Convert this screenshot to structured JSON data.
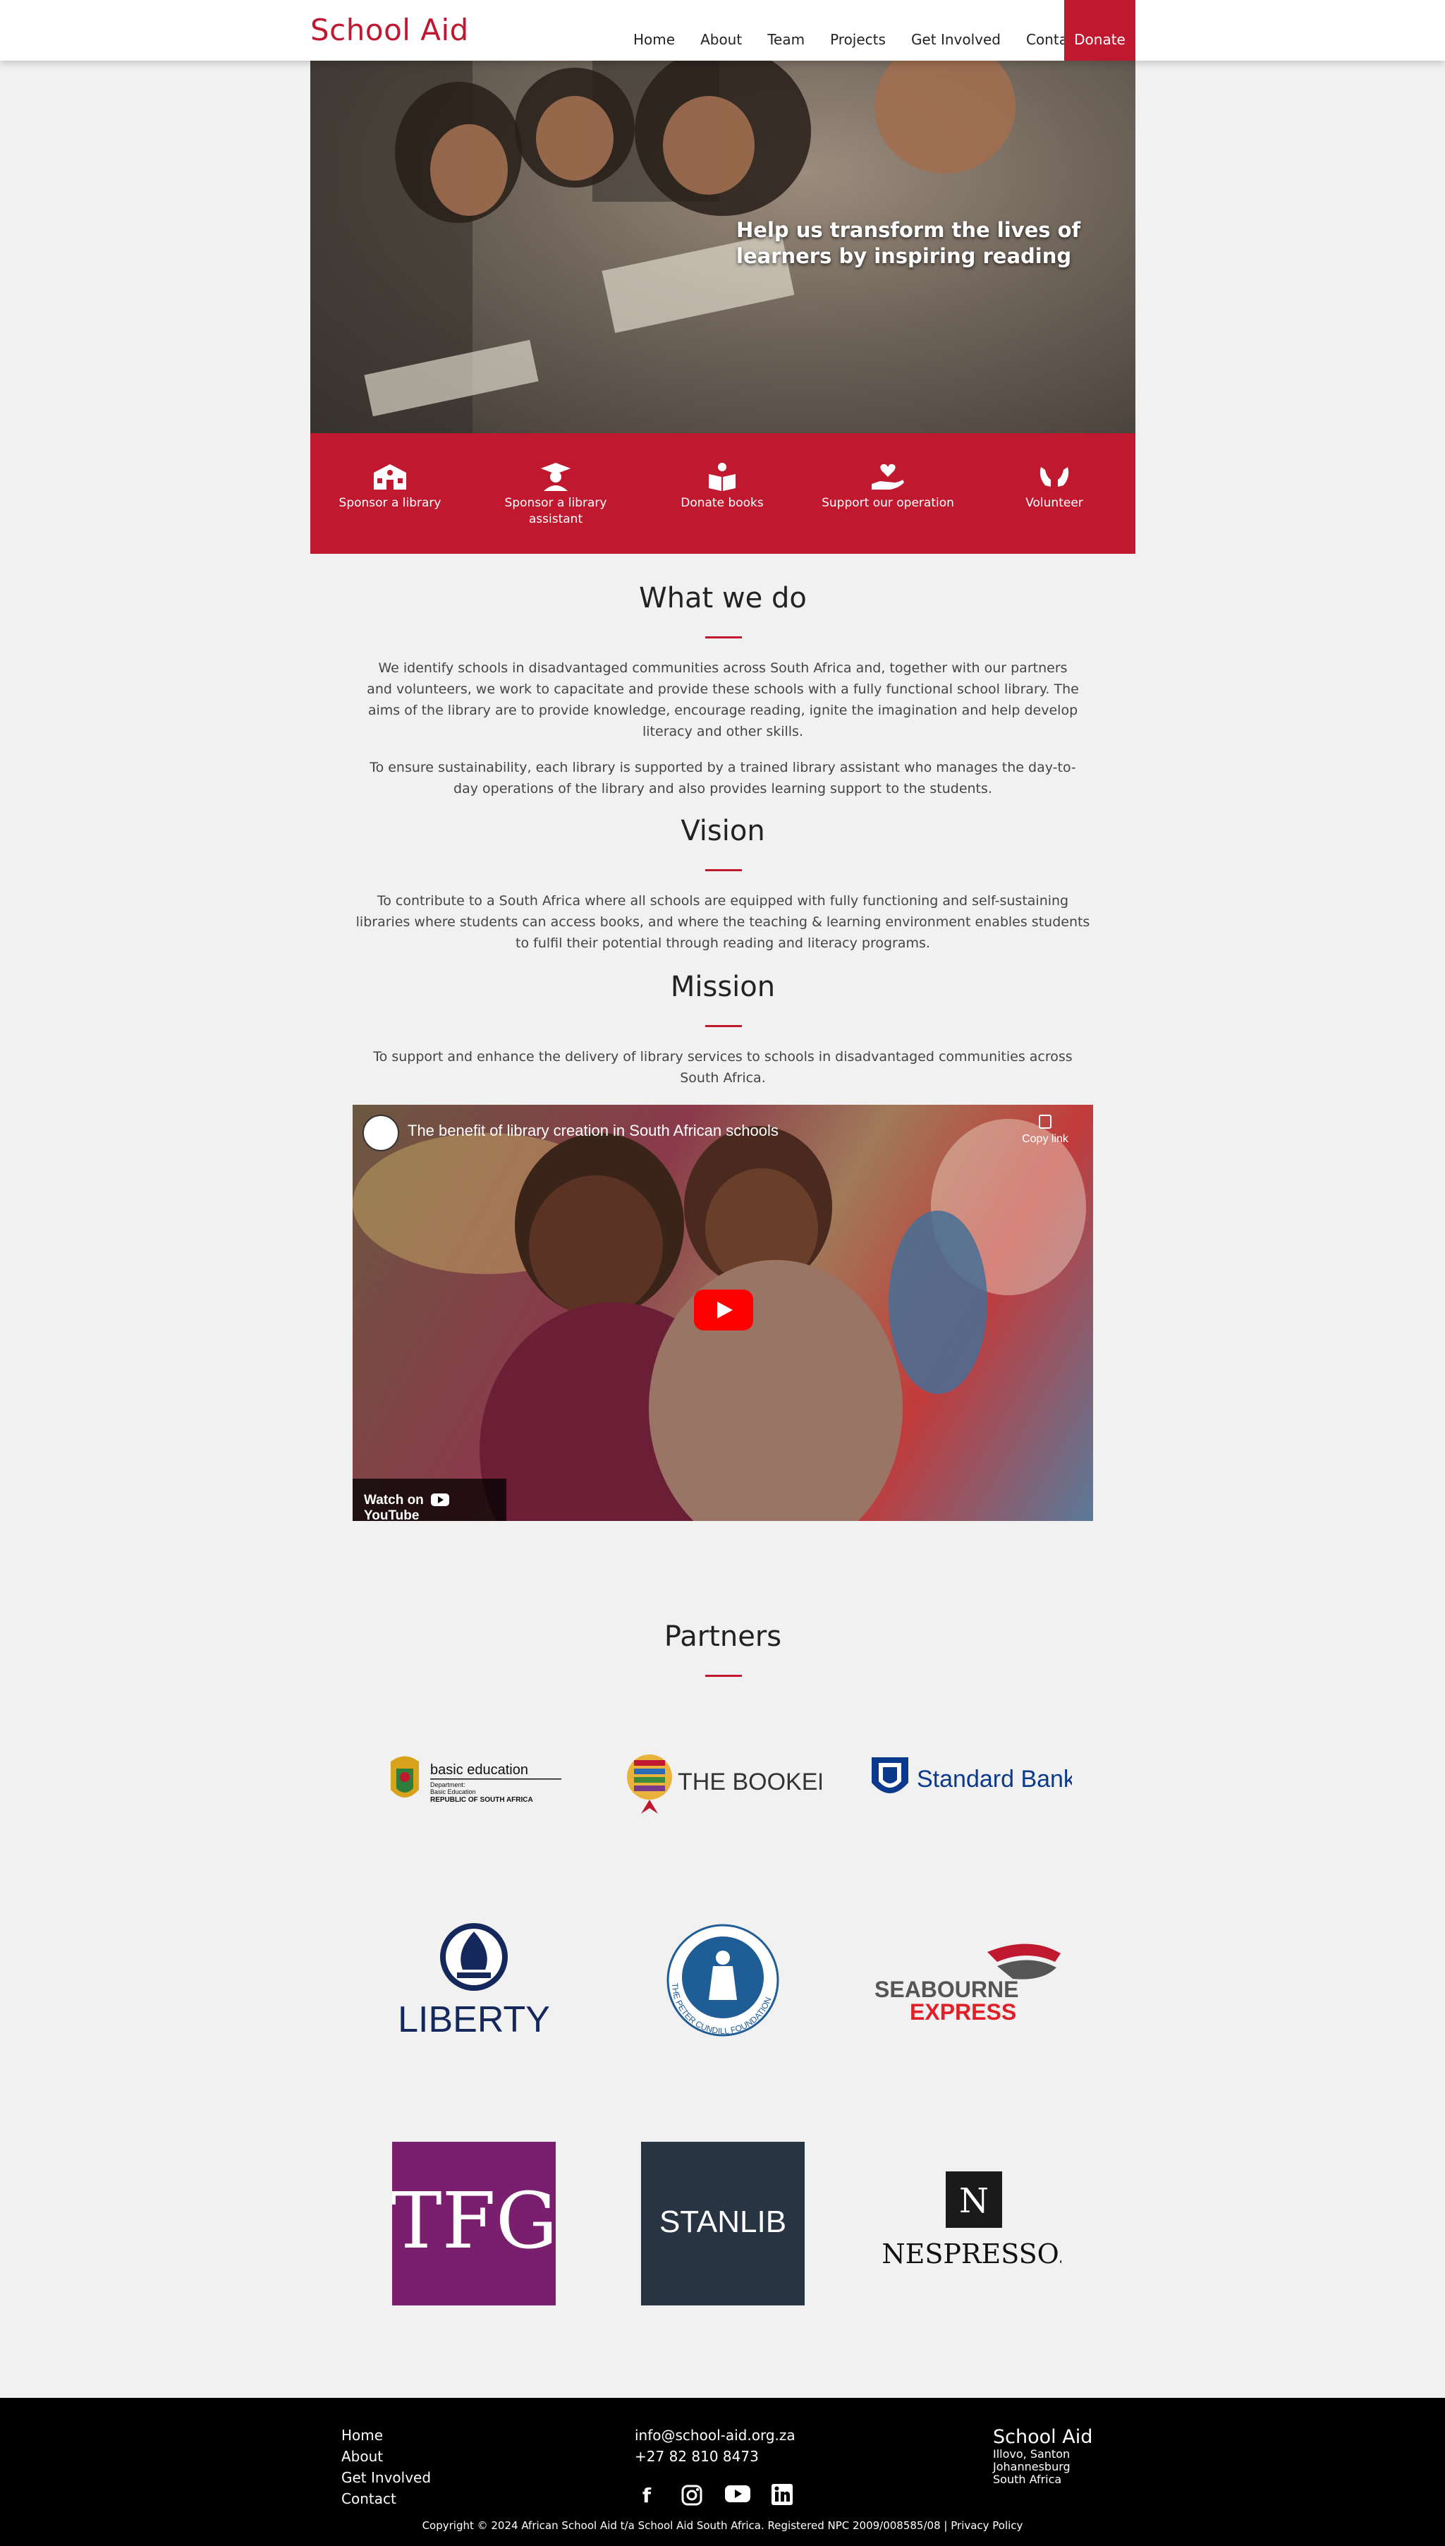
{
  "nav": {
    "logo": "School Aid",
    "items": [
      "Home",
      "About",
      "Team",
      "Projects",
      "Get Involved",
      "Contact"
    ],
    "donate": "Donate"
  },
  "hero": {
    "headline": "Help us transform the lives of learners by inspiring reading"
  },
  "actions": [
    {
      "label": "Sponsor a library",
      "icon": "school-icon"
    },
    {
      "label": "Sponsor a library assistant",
      "icon": "graduate-icon"
    },
    {
      "label": "Donate books",
      "icon": "book-icon"
    },
    {
      "label": "Support our operation",
      "icon": "heart-hand-icon"
    },
    {
      "label": "Volunteer",
      "icon": "hands-icon"
    }
  ],
  "what_we_do": {
    "title": "What we do",
    "p1": "We identify schools in disadvantaged communities across South Africa and, together with our partners and volunteers, we work to capacitate and provide these schools with a fully functional school library. The aims of the library are to provide knowledge, encourage reading, ignite the imagination and help develop literacy and other skills.",
    "p2": "To ensure sustainability, each library is supported by a trained library assistant who manages the day-to-day operations of the library and also provides learning support to the students."
  },
  "vision": {
    "title": "Vision",
    "text": "To contribute to a South Africa where all schools are equipped with fully functioning and self-sustaining libraries where students can access books, and where the teaching & learning environment enables students to fulfil their potential through reading and literacy programs."
  },
  "mission": {
    "title": "Mission",
    "text": "To support and enhance the delivery of library services to schools in disadvantaged communities across South Africa."
  },
  "video": {
    "title": "The benefit of library creation in South African schools",
    "copy_link": "Copy link",
    "watch_on": "Watch on",
    "youtube": "YouTube"
  },
  "partners": {
    "title": "Partners",
    "basic_ed": {
      "line1": "basic education",
      "line2": "Department:",
      "line3": "Basic Education",
      "line4": "REPUBLIC OF SOUTH AFRICA"
    },
    "bookery": "THE BOOKERY",
    "standard_bank": "Standard Bank",
    "liberty": "LIBERTY",
    "cundill": "THE PETER CUNDILL FOUNDATION",
    "seabourne1": "SEABOURNE",
    "seabourne2": "EXPRESS",
    "tfg": "TFG",
    "stanlib": "STANLIB",
    "nespresso": "NESPRESSO."
  },
  "footer": {
    "links": [
      "Home",
      "About",
      "Get Involved",
      "Contact"
    ],
    "email": "info@school-aid.org.za",
    "phone": "+27 82 810 8473",
    "social": [
      "facebook-icon",
      "instagram-icon",
      "youtube-icon",
      "linkedin-icon"
    ],
    "brand": "School Aid",
    "address": [
      "Illovo, Santon",
      "Johannesburg",
      "South Africa"
    ],
    "copyright": "Copyright © 2024 African School Aid t/a School Aid South Africa. Registered NPC 2009/008585/08 | Privacy Policy"
  },
  "colors": {
    "brand_red": "#c0192f",
    "footer_bg": "#000000"
  }
}
